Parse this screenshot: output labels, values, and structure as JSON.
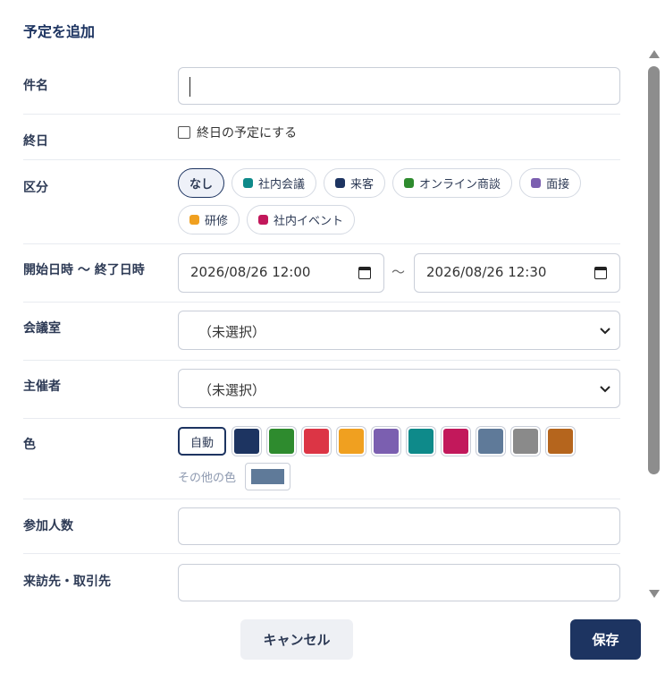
{
  "dialog": {
    "title": "予定を追加",
    "cancel_label": "キャンセル",
    "save_label": "保存"
  },
  "fields": {
    "subject": {
      "label": "件名",
      "value": ""
    },
    "all_day": {
      "label": "終日",
      "checkbox_label": "終日の予定にする",
      "checked": false
    },
    "category": {
      "label": "区分",
      "options": [
        {
          "label": "なし",
          "color": "",
          "selected": true
        },
        {
          "label": "社内会議",
          "color": "#0e8a8a",
          "selected": false
        },
        {
          "label": "来客",
          "color": "#1d3461",
          "selected": false
        },
        {
          "label": "オンライン商談",
          "color": "#2e8b2e",
          "selected": false
        },
        {
          "label": "面接",
          "color": "#7b5fb0",
          "selected": false
        },
        {
          "label": "研修",
          "color": "#f0a020",
          "selected": false
        },
        {
          "label": "社内イベント",
          "color": "#c2185b",
          "selected": false
        }
      ]
    },
    "datetime": {
      "label": "開始日時 〜 終了日時",
      "start": "2026/08/26 12:00",
      "separator": "～",
      "end": "2026/08/26 12:30"
    },
    "room": {
      "label": "会議室",
      "value": "（未選択）"
    },
    "organizer": {
      "label": "主催者",
      "value": "（未選択）"
    },
    "color": {
      "label": "色",
      "auto_label": "自動",
      "swatches": [
        "#1d3461",
        "#2e8b2e",
        "#dc3545",
        "#f0a020",
        "#7b5fb0",
        "#0e8a8a",
        "#c2185b",
        "#5f7a99",
        "#8a8a8a",
        "#b5651d"
      ],
      "other_label": "その他の色",
      "other_value": "#5f7a99"
    },
    "attendees": {
      "label": "参加人数",
      "value": ""
    },
    "visitor": {
      "label": "来訪先・取引先",
      "value": ""
    }
  }
}
